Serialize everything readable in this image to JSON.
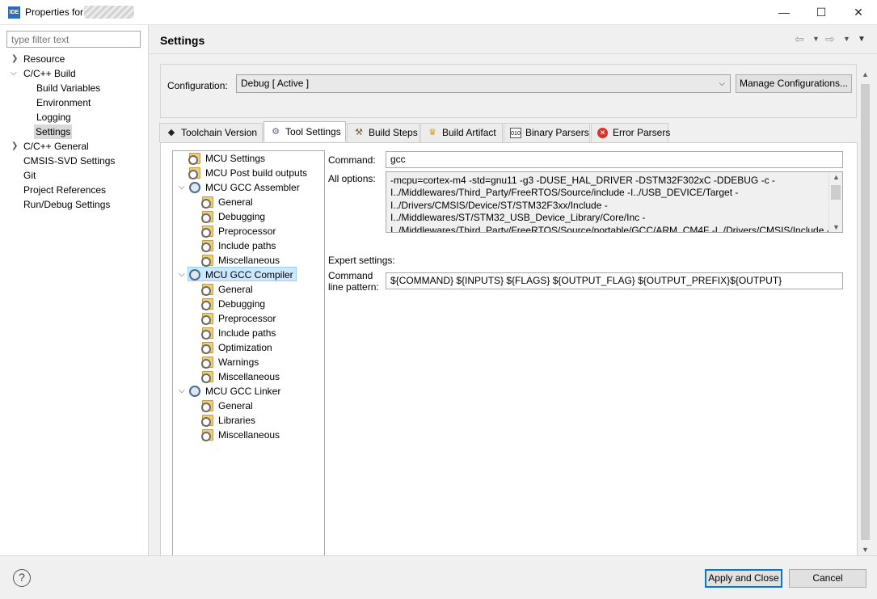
{
  "window": {
    "title": "Properties for",
    "logo": "IDE",
    "minimize": "—",
    "maximize": "☐",
    "close": "✕"
  },
  "sidebar": {
    "filter_placeholder": "type filter text",
    "items": [
      {
        "label": "Resource"
      },
      {
        "label": "C/C++ Build"
      },
      {
        "label": "Build Variables"
      },
      {
        "label": "Environment"
      },
      {
        "label": "Logging"
      },
      {
        "label": "Settings"
      },
      {
        "label": "C/C++ General"
      },
      {
        "label": "CMSIS-SVD Settings"
      },
      {
        "label": "Git"
      },
      {
        "label": "Project References"
      },
      {
        "label": "Run/Debug Settings"
      }
    ]
  },
  "header": {
    "title": "Settings"
  },
  "configuration": {
    "label": "Configuration:",
    "value": "Debug  [ Active ]",
    "manage_label": "Manage Configurations..."
  },
  "tabs": [
    {
      "label": "Toolchain  Version",
      "icon": "chip-icon"
    },
    {
      "label": "Tool Settings",
      "icon": "gear-icon"
    },
    {
      "label": "Build Steps",
      "icon": "hammer-icon"
    },
    {
      "label": "Build Artifact",
      "icon": "trophy-icon"
    },
    {
      "label": "Binary Parsers",
      "icon": "binary-icon"
    },
    {
      "label": "Error Parsers",
      "icon": "error-icon"
    }
  ],
  "tree": {
    "items": [
      {
        "label": "MCU Settings"
      },
      {
        "label": "MCU Post build outputs"
      },
      {
        "label": "MCU GCC Assembler"
      },
      {
        "label": "General"
      },
      {
        "label": "Debugging"
      },
      {
        "label": "Preprocessor"
      },
      {
        "label": "Include paths"
      },
      {
        "label": "Miscellaneous"
      },
      {
        "label": "MCU GCC Compiler"
      },
      {
        "label": "General"
      },
      {
        "label": "Debugging"
      },
      {
        "label": "Preprocessor"
      },
      {
        "label": "Include paths"
      },
      {
        "label": "Optimization"
      },
      {
        "label": "Warnings"
      },
      {
        "label": "Miscellaneous"
      },
      {
        "label": "MCU GCC Linker"
      },
      {
        "label": "General"
      },
      {
        "label": "Libraries"
      },
      {
        "label": "Miscellaneous"
      }
    ]
  },
  "fields": {
    "command_label": "Command:",
    "command_value": "gcc",
    "all_options_label": "All options:",
    "all_options_value": "-mcpu=cortex-m4 -std=gnu11 -g3 -DUSE_HAL_DRIVER -DSTM32F302xC -DDEBUG -c -\nI../Middlewares/Third_Party/FreeRTOS/Source/include -I../USB_DEVICE/Target -\nI../Drivers/CMSIS/Device/ST/STM32F3xx/Include -\nI../Middlewares/ST/STM32_USB_Device_Library/Core/Inc -\nI../Middlewares/Third_Party/FreeRTOS/Source/portable/GCC/ARM_CM4F -I../Drivers/CMSIS/Include -",
    "expert_label": "Expert settings:",
    "cmdline_label_1": "Command",
    "cmdline_label_2": "line pattern:",
    "cmdline_value": "${COMMAND} ${INPUTS} ${FLAGS} ${OUTPUT_FLAG} ${OUTPUT_PREFIX}${OUTPUT}"
  },
  "footer": {
    "help_label": "?",
    "apply_label": "Apply and Close",
    "cancel_label": "Cancel"
  }
}
